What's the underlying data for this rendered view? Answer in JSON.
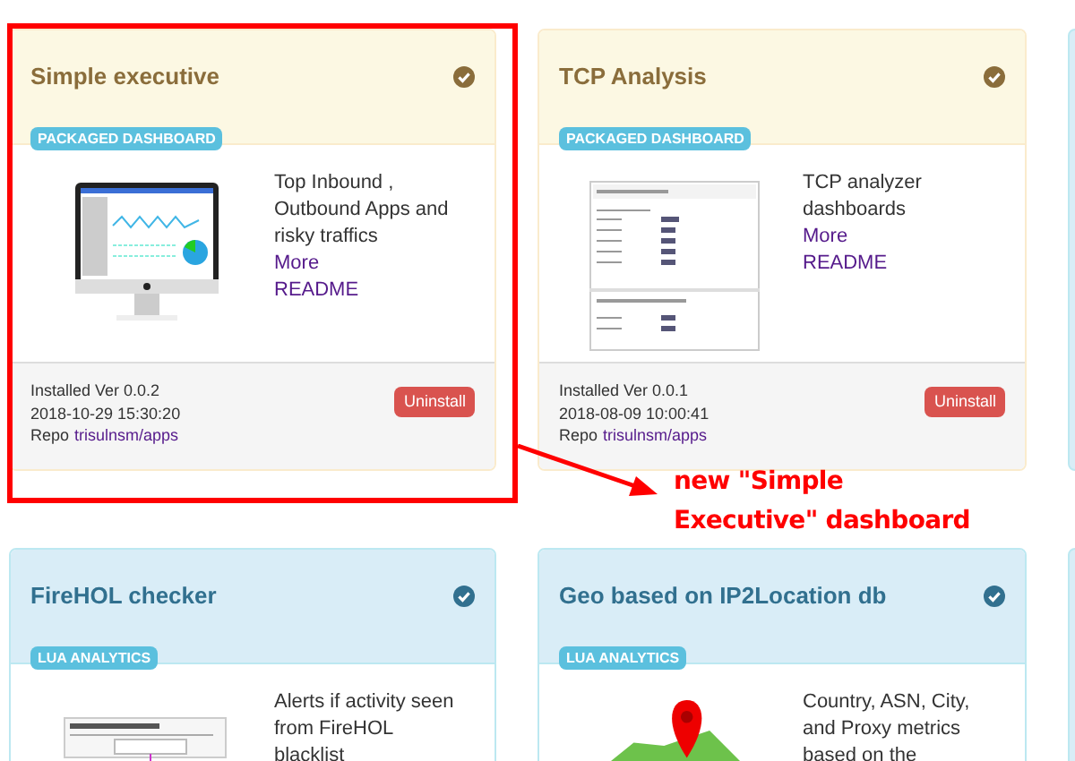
{
  "cards": [
    {
      "title": "Simple executive",
      "kind": "dashboard",
      "checked": true,
      "badge": "PACKAGED DASHBOARD",
      "description": [
        "Top Inbound ,",
        "Outbound Apps and",
        "risky traffics"
      ],
      "links": [
        "More",
        "README"
      ],
      "installed": "Installed Ver 0.0.2",
      "date": "2018-10-29 15:30:20",
      "repo_label": "Repo",
      "repo": "trisulnsm/apps",
      "action": "Uninstall"
    },
    {
      "title": "TCP Analysis",
      "kind": "dashboard",
      "checked": true,
      "badge": "PACKAGED DASHBOARD",
      "description": [
        "TCP analyzer",
        "dashboards"
      ],
      "links": [
        "More",
        "README"
      ],
      "installed": "Installed Ver 0.0.1",
      "date": "2018-08-09 10:00:41",
      "repo_label": "Repo",
      "repo": "trisulnsm/apps",
      "action": "Uninstall"
    },
    {
      "title": "FireHOL checker",
      "kind": "lua",
      "checked": true,
      "badge": "LUA ANALYTICS",
      "description": [
        "Alerts if activity seen",
        "from FireHOL",
        "blacklist"
      ]
    },
    {
      "title": "Geo based on IP2Location db",
      "kind": "lua",
      "checked": true,
      "badge": "LUA ANALYTICS",
      "description": [
        "Country, ASN, City,",
        "and Proxy metrics",
        "based on the"
      ]
    }
  ],
  "annotation": {
    "lines": [
      "new \"Simple",
      "Executive\" dashboard"
    ]
  }
}
